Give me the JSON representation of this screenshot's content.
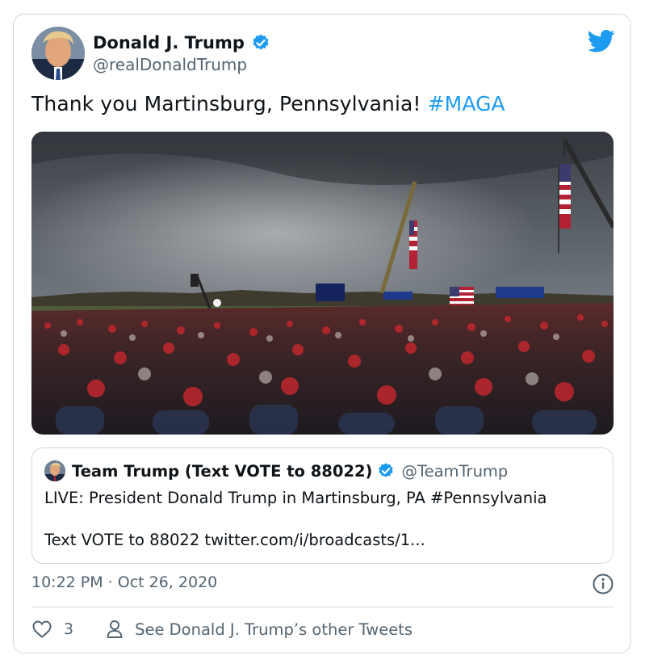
{
  "colors": {
    "accent": "#1d9bf0",
    "text": "#0f1419",
    "muted": "#536471",
    "border": "#cfd9de"
  },
  "tweet": {
    "author_name": "Donald J. Trump",
    "author_handle": "@realDonaldTrump",
    "text": "Thank you Martinsburg, Pennsylvania! ",
    "hashtag": "#MAGA",
    "timestamp": "10:22 PM · Oct 26, 2020",
    "like_count": "3",
    "profile_link_text": "See Donald J. Trump’s other Tweets"
  },
  "quoted_tweet": {
    "author_name": "Team Trump (Text VOTE to 88022)",
    "author_handle": "@TeamTrump",
    "line1": "LIVE: President Donald Trump in Martinsburg, PA #Pennsylvania",
    "line2": "Text VOTE to 88022 twitter.com/i/broadcasts/1..."
  },
  "icons": {
    "brand": "twitter-bird-icon",
    "verified": "verified-badge-icon",
    "info": "info-icon",
    "like": "heart-icon",
    "profile": "person-icon"
  }
}
